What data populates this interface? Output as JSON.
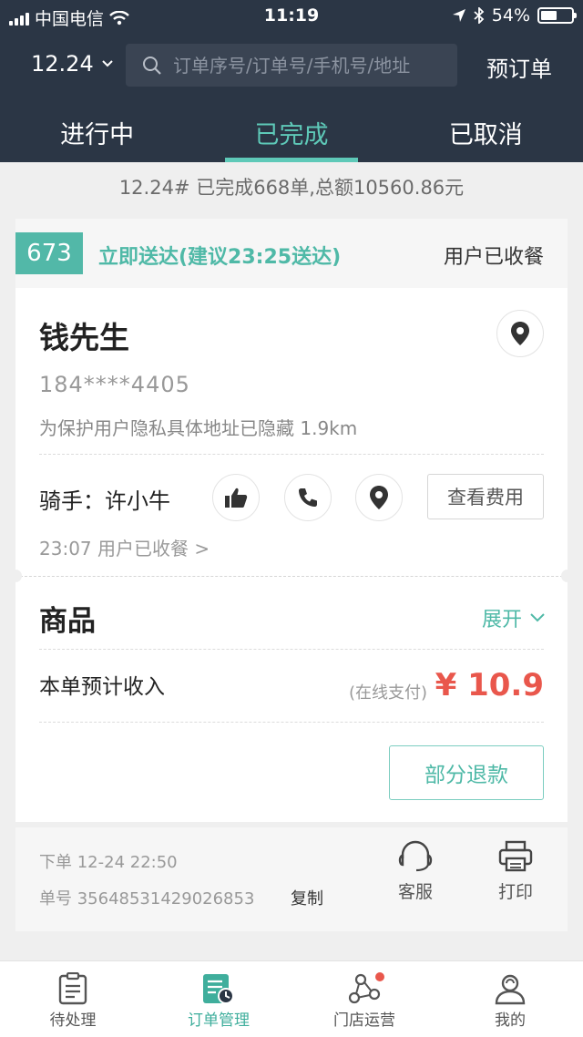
{
  "status_bar": {
    "carrier": "中国电信",
    "time": "11:19",
    "battery": "54%",
    "battery_level": 0.54
  },
  "header": {
    "date_selector": "12.24",
    "search_placeholder": "订单序号/订单号/手机号/地址",
    "pre_order": "预订单"
  },
  "tabs": [
    {
      "label": "进行中",
      "active": false
    },
    {
      "label": "已完成",
      "active": true
    },
    {
      "label": "已取消",
      "active": false
    }
  ],
  "summary": "12.24# 已完成668单,总额10560.86元",
  "order": {
    "number": "673",
    "delivery": "立即送达(建议23:25送达)",
    "status": "用户已收餐",
    "customer_name": "钱先生",
    "phone": "184****4405",
    "address": "为保护用户隐私具体地址已隐藏   1.9km",
    "rider_label": "骑手：",
    "rider_name": "许小牛",
    "view_fee": "查看费用",
    "timeline": "23:07   用户已收餐 >",
    "goods_title": "商品",
    "expand": "展开",
    "income_label": "本单预计收入",
    "pay_method": "(在线支付)",
    "amount": "¥ 10.9",
    "refund": "部分退款",
    "order_time": "下单 12-24 22:50",
    "order_id": "单号 35648531429026853",
    "copy": "复制",
    "service": "客服",
    "print": "打印"
  },
  "bottom_nav": [
    {
      "label": "待处理",
      "icon": "clipboard-icon",
      "active": false
    },
    {
      "label": "订单管理",
      "icon": "order-manage-icon",
      "active": true
    },
    {
      "label": "门店运营",
      "icon": "store-operation-icon",
      "active": false,
      "badge": true
    },
    {
      "label": "我的",
      "icon": "profile-icon",
      "active": false
    }
  ],
  "colors": {
    "header_bg": "#2b3645",
    "accent": "#52b8a8",
    "price": "#e9574c"
  }
}
